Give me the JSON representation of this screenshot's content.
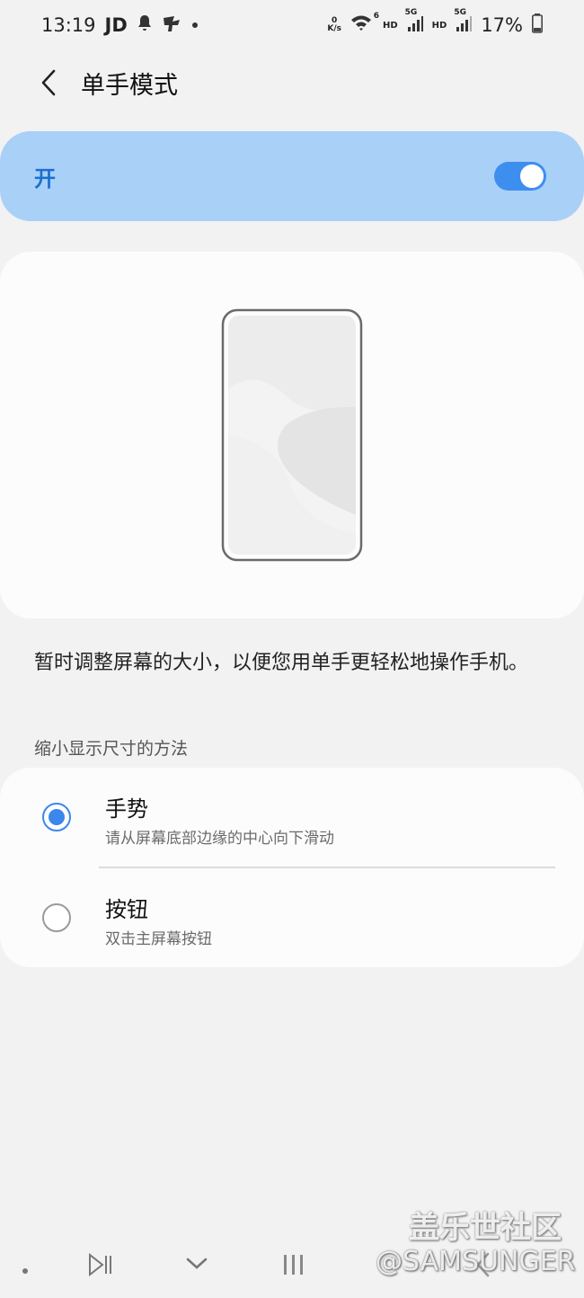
{
  "status_bar": {
    "time": "13:19",
    "carrier_tag": "JD",
    "net_speed_value": "0",
    "net_speed_unit": "K/s",
    "wifi_label": "6",
    "sig1_label": "5G",
    "hd1": "HD",
    "hd2": "HD",
    "sig2_label": "5G",
    "battery": "17%",
    "icons": [
      "bell-icon",
      "app-icon",
      "dot-icon",
      "wifi-icon",
      "signal-icon",
      "signal-icon",
      "battery-icon"
    ]
  },
  "header": {
    "title": "单手模式"
  },
  "master_switch": {
    "label": "开",
    "state": true,
    "accent": "#3e8ef0",
    "background": "#a9d0f7"
  },
  "description": "暂时调整屏幕的大小，以便您用单手更轻松地操作手机。",
  "section_label": "缩小显示尺寸的方法",
  "options": [
    {
      "title": "手势",
      "subtitle": "请从屏幕底部边缘的中心向下滑动",
      "selected": true
    },
    {
      "title": "按钮",
      "subtitle": "双击主屏幕按钮",
      "selected": false
    }
  ],
  "watermark": {
    "line1": "盖乐世社区",
    "line2": "@SAMSUNGER"
  },
  "nav_bar": {
    "icons": [
      "dot-icon",
      "play-pause-icon",
      "chevron-down-icon",
      "recents-icon",
      "back-icon"
    ]
  }
}
